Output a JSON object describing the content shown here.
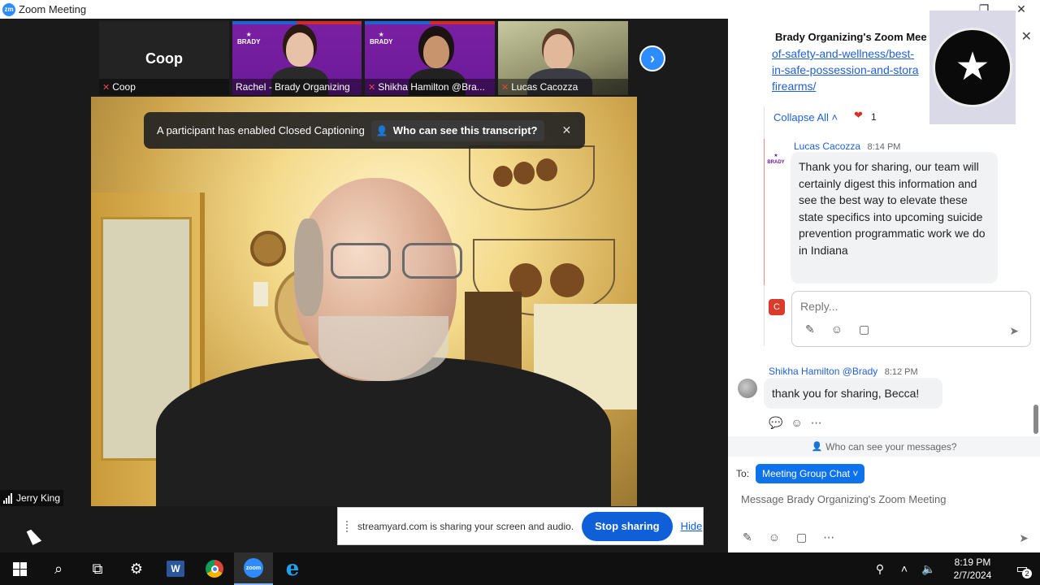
{
  "window": {
    "logo_text": "zm",
    "title": "Zoom Meeting",
    "minimize": "–",
    "restore": "❐",
    "close": "✕"
  },
  "thumbnails": {
    "coop": {
      "big_name": "Coop",
      "label": "Coop"
    },
    "rachel": {
      "label": "Rachel - Brady Organizing",
      "brand": "BRADY"
    },
    "shikha": {
      "label": "Shikha Hamilton @Bra...",
      "brand": "BRADY"
    },
    "lucas": {
      "label": "Lucas Cacozza"
    },
    "next_icon": "›"
  },
  "caption_toast": {
    "text": "A participant has enabled Closed Captioning",
    "who_button": "Who can see this transcript?",
    "close": "✕"
  },
  "self_view": {
    "name": "Jerry King"
  },
  "share_bar": {
    "text": "streamyard.com is sharing your screen and audio.",
    "stop": "Stop sharing",
    "hide": "Hide"
  },
  "chat": {
    "header": "Brady Organizing's Zoom Mee",
    "close": "✕",
    "link_text": "of-safety-and-wellness/best-in-safe-possession-and-storage-firearms/",
    "link_lines": [
      "of-safety-and-wellness/best-",
      "in-safe-possession-and-stora",
      "firearms/"
    ],
    "collapse_all": "Collapse All ˄",
    "heart": "❤",
    "heart_count": "1",
    "lucas_msg": {
      "name": "Lucas Cacozza",
      "time": "8:14 PM",
      "avatar_text": "BRADY",
      "text": "Thank you for sharing, our team will certainly digest this information and see the best way to elevate these state specifics into upcoming suicide prevention programmatic work we do in Indiana"
    },
    "reply": {
      "avatar": "C",
      "placeholder": "Reply..."
    },
    "shikha_msg": {
      "name": "Shikha Hamilton @Brady",
      "time": "8:12 PM",
      "text": "thank you for sharing, Becca!"
    },
    "who_can_see": "Who can see your messages?",
    "to_label": "To:",
    "to_chip": "Meeting Group Chat ˅",
    "input_placeholder": "Message Brady Organizing's Zoom Meeting"
  },
  "taskbar": {
    "word": "W",
    "zoom": "zoom",
    "ie": "e",
    "time": "8:19 PM",
    "date": "2/7/2024",
    "notif_count": "2"
  },
  "colors": {
    "zoom_blue": "#2d8cff",
    "brady_purple": "#6a1b9a",
    "link_blue": "#1f60d6",
    "stop_blue": "#0e5fd8"
  }
}
